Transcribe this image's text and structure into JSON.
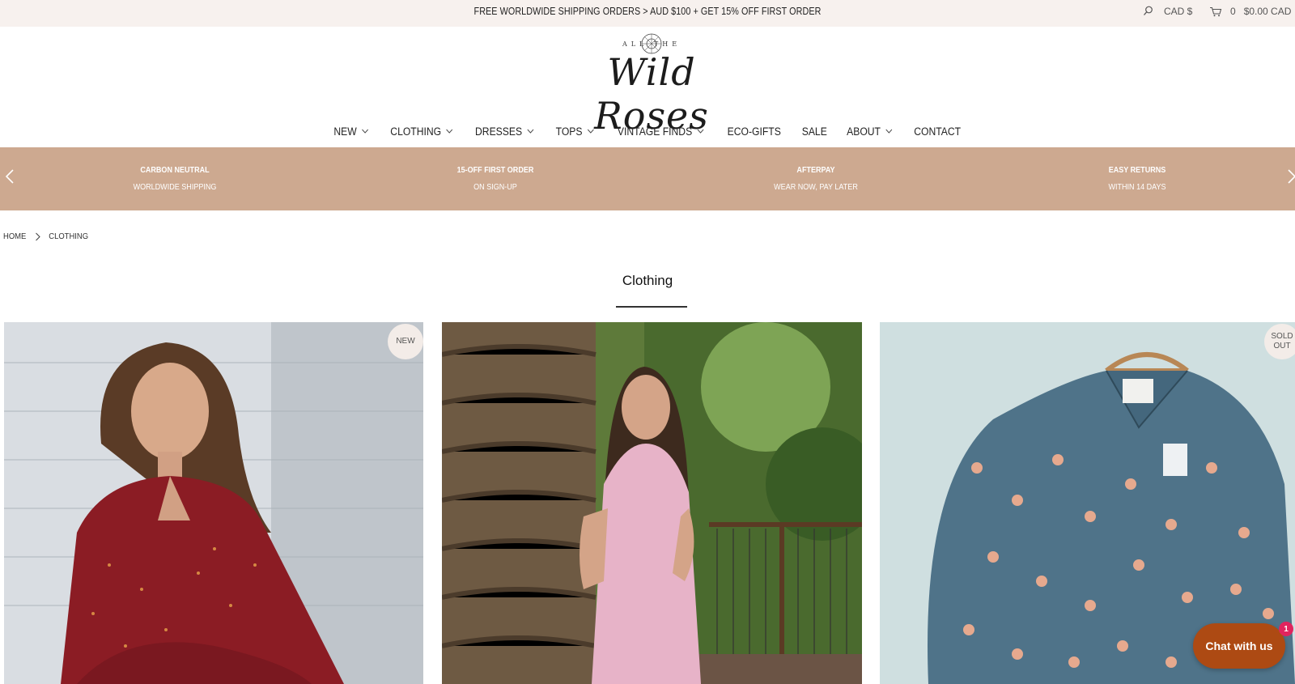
{
  "announcement": "FREE WORLDWIDE SHIPPING ORDERS > AUD $100 + GET 15% OFF FIRST ORDER",
  "utility": {
    "currency": "CAD $",
    "cart_count": "0",
    "cart_total": "$0.00 CAD",
    "icons": {
      "search": "search-icon",
      "cart": "cart-icon"
    }
  },
  "logo": {
    "small_text": "ALL THE",
    "script_text": "Wild Roses"
  },
  "nav": {
    "items": [
      {
        "label": "NEW",
        "has_dropdown": true
      },
      {
        "label": "CLOTHING",
        "has_dropdown": true
      },
      {
        "label": "DRESSES",
        "has_dropdown": true
      },
      {
        "label": "TOPS",
        "has_dropdown": true
      },
      {
        "label": "VINTAGE FINDS",
        "has_dropdown": true
      },
      {
        "label": "ECO-GIFTS",
        "has_dropdown": false
      },
      {
        "label": "SALE",
        "has_dropdown": false
      },
      {
        "label": "ABOUT",
        "has_dropdown": true
      },
      {
        "label": "CONTACT",
        "has_dropdown": false
      }
    ]
  },
  "benefits": [
    {
      "title": "CARBON NEUTRAL",
      "subtitle": "WORLDWIDE SHIPPING"
    },
    {
      "title": "15-OFF FIRST ORDER",
      "subtitle": "ON SIGN-UP"
    },
    {
      "title": "AFTERPAY",
      "subtitle": "WEAR NOW, PAY LATER"
    },
    {
      "title": "EASY RETURNS",
      "subtitle": "WITHIN 14 DAYS"
    }
  ],
  "breadcrumb": {
    "home": "HOME",
    "current": "CLOTHING"
  },
  "page_title": "Clothing",
  "products": [
    {
      "badge": "NEW",
      "image": "woman in red floral dress"
    },
    {
      "badge": "",
      "image": "woman in pink striped dress by palm tree"
    },
    {
      "badge_line1": "SOLD",
      "badge_line2": "OUT",
      "image": "blue floral blouse on hanger"
    }
  ],
  "chat": {
    "label": "Chat with us",
    "count": "1"
  },
  "colors": {
    "band": "#cda990",
    "announce_bg": "#f7f1ee",
    "chat": "#ad4a13",
    "chat_badge": "#e0245e"
  }
}
